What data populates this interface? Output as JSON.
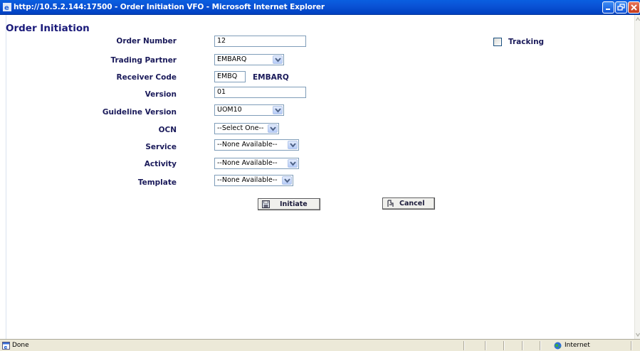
{
  "window": {
    "title": "http://10.5.2.144:17500 - Order Initiation VFO - Microsoft Internet Explorer",
    "icons": {
      "app": "ie-icon",
      "minimize": "minimize-icon",
      "maximize": "restore-icon",
      "close": "close-icon"
    }
  },
  "page": {
    "heading": "Order Initiation"
  },
  "form": {
    "order_number": {
      "label": "Order Number",
      "value": "12"
    },
    "tracking": {
      "label": "Tracking",
      "checked": false
    },
    "trading_partner": {
      "label": "Trading Partner",
      "value": "EMBARQ"
    },
    "receiver_code": {
      "label": "Receiver Code",
      "value": "EMBQ",
      "name": "EMBARQ"
    },
    "version": {
      "label": "Version",
      "value": "01"
    },
    "guideline_version": {
      "label": "Guideline Version",
      "value": "UOM10"
    },
    "ocn": {
      "label": "OCN",
      "value": "--Select One--"
    },
    "service": {
      "label": "Service",
      "value": "--None Available--"
    },
    "activity": {
      "label": "Activity",
      "value": "--None Available--"
    },
    "template": {
      "label": "Template",
      "value": "--None Available--"
    }
  },
  "buttons": {
    "initiate": "Initiate",
    "cancel": "Cancel"
  },
  "statusbar": {
    "status": "Done",
    "zone": "Internet"
  },
  "colors": {
    "titlebar": "#0a53d6",
    "heading": "#1a1a7a",
    "label": "#1a1a5a",
    "statusbar": "#ece9d8"
  }
}
